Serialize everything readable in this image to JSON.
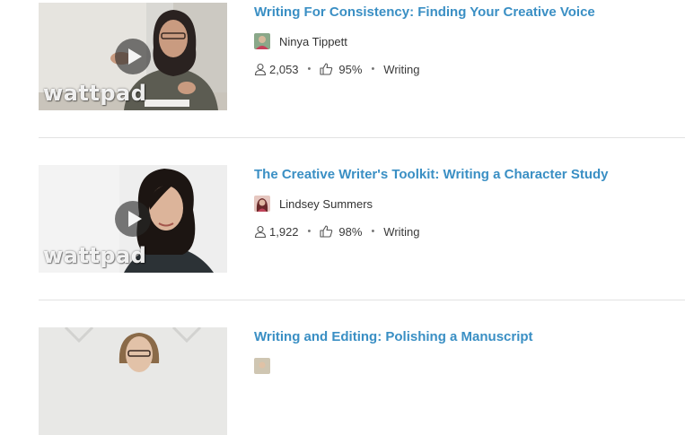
{
  "courses": [
    {
      "title": "Writing For Consistency: Finding Your Creative Voice",
      "author": "Ninya Tippett",
      "students": "2,053",
      "rating": "95%",
      "category": "Writing",
      "thumb_brand": "wattpad",
      "thumb_bg": "#dcdcdc",
      "avatar_color": "#8aa889"
    },
    {
      "title": "The Creative Writer's Toolkit: Writing a Character Study",
      "author": "Lindsey Summers",
      "students": "1,922",
      "rating": "98%",
      "category": "Writing",
      "thumb_brand": "wattpad",
      "thumb_bg": "#eeeeee",
      "avatar_color": "#c0445a"
    },
    {
      "title": "Writing and Editing: Polishing a Manuscript",
      "thumb_bg": "#e6e6e6"
    }
  ],
  "icons": {
    "play": "play-icon",
    "students": "user-icon",
    "rating": "thumbs-up-icon"
  },
  "colors": {
    "link": "#3a8fc4",
    "text": "#333333",
    "divider": "#e2e2e2"
  }
}
